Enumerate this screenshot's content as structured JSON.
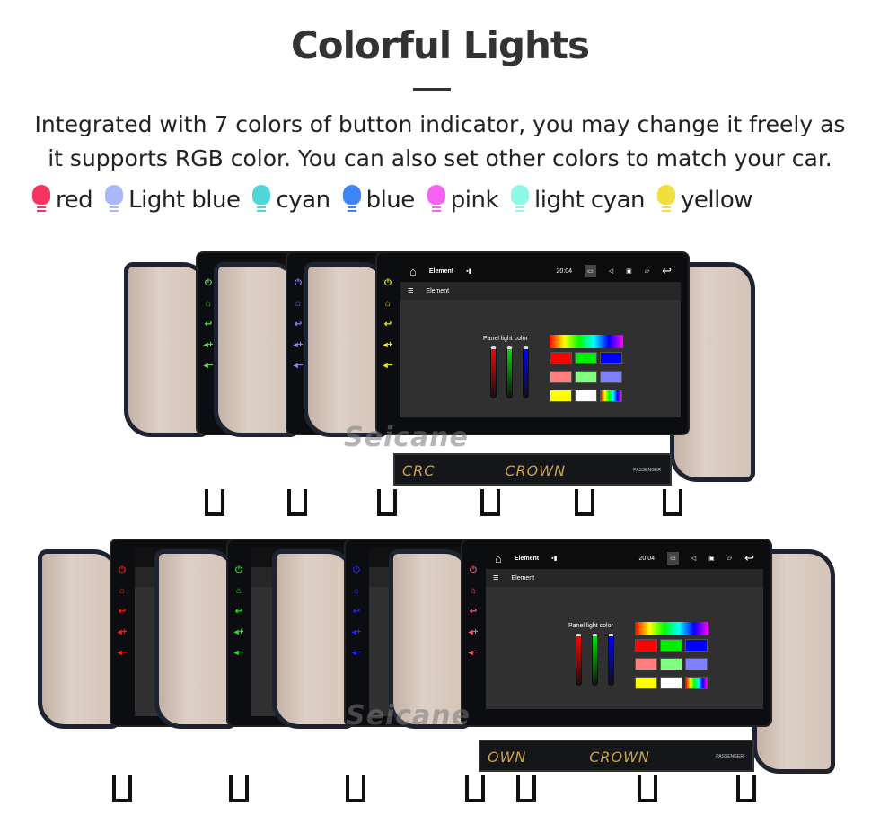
{
  "heading": {
    "title": "Colorful Lights",
    "line1": "Integrated with 7 colors of button indicator, you may change it freely as",
    "line2": "it supports RGB color. You can also set other colors to match your car."
  },
  "legend": [
    {
      "label": "red",
      "color": "#f7345f"
    },
    {
      "label": "Light blue",
      "color": "#a9b8f8"
    },
    {
      "label": "cyan",
      "color": "#4fd6d8"
    },
    {
      "label": "blue",
      "color": "#3f86f4"
    },
    {
      "label": "pink",
      "color": "#f862f2"
    },
    {
      "label": "light cyan",
      "color": "#8ef7e6"
    },
    {
      "label": "yellow",
      "color": "#f1df3c"
    }
  ],
  "screen": {
    "app_title": "Element",
    "menu_title": "Element",
    "time": "20:04",
    "panel_label": "Panel light color",
    "swatches": [
      "#ff0000",
      "#00ee00",
      "#0000ff",
      "#ff8080",
      "#80ff80",
      "#8080ff",
      "#ffff00",
      "#ffffff",
      "rainbow"
    ]
  },
  "car": {
    "badge": "CROWN",
    "badge_partial_top": "CRC",
    "badge_partial_bottom": "OWN",
    "passenger": "PASSENGER"
  },
  "watermark": "Seicane",
  "top_row_button_colors": [
    "#5fd35f",
    "#8b84f4",
    "#e6e61a"
  ],
  "bottom_row_button_colors": [
    "#ff1a1a",
    "#22dd22",
    "#2222ff",
    "#e07a86",
    "#ee5a6e"
  ]
}
